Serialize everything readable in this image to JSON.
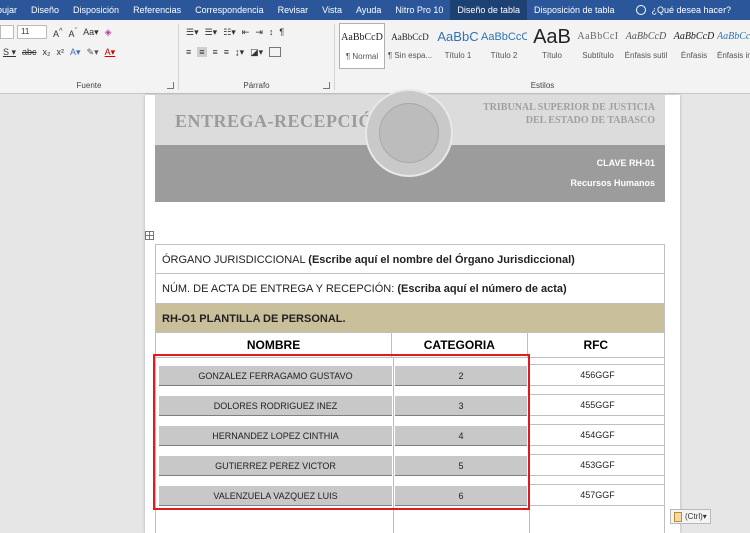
{
  "ribbon_tabs": [
    {
      "label": "bujar"
    },
    {
      "label": "Diseño"
    },
    {
      "label": "Disposición"
    },
    {
      "label": "Referencias"
    },
    {
      "label": "Correspondencia"
    },
    {
      "label": "Revisar"
    },
    {
      "label": "Vista"
    },
    {
      "label": "Ayuda"
    },
    {
      "label": "Nitro Pro 10"
    },
    {
      "label": "Diseño de tabla"
    },
    {
      "label": "Disposición de tabla"
    }
  ],
  "tell_me": "¿Qué desea hacer?",
  "groups": {
    "font_label": "Fuente",
    "paragraph_label": "Párrafo",
    "styles_label": "Estilos",
    "font_size": "11"
  },
  "styles": [
    {
      "sample": "AaBbCcD",
      "name": "¶ Normal"
    },
    {
      "sample": "AaBbCcD",
      "name": "¶ Sin espa..."
    },
    {
      "sample": "AaBbC",
      "name": "Título 1"
    },
    {
      "sample": "AaBbCcC",
      "name": "Título 2"
    },
    {
      "sample": "AaB",
      "name": "Título"
    },
    {
      "sample": "AaBbCcI",
      "name": "Subtítulo"
    },
    {
      "sample": "AaBbCcD",
      "name": "Énfasis sutil"
    },
    {
      "sample": "AaBbCcD",
      "name": "Énfasis"
    },
    {
      "sample": "AaBbCcD",
      "name": "Énfasis int..."
    }
  ],
  "header": {
    "title": "ENTREGA-RECEPCIÓN",
    "court_line1": "TRIBUNAL SUPERIOR DE JUSTICIA",
    "court_line2": "DEL ESTADO DE TABASCO",
    "clave": "CLAVE RH-01",
    "area": "Recursos Humanos"
  },
  "form": {
    "organo_label": "ÓRGANO JURISDICCIONAL",
    "organo_value": "(Escribe aquí el nombre del Órgano Jurisdiccional)",
    "acta_label": "NÚM. DE ACTA DE ENTREGA Y RECEPCIÓN:",
    "acta_value": "(Escriba aquí el número de acta)",
    "section_title": "RH-O1 PLANTILLA DE PERSONAL."
  },
  "table": {
    "headers": [
      "NOMBRE",
      "CATEGORIA",
      "RFC"
    ],
    "rows": [
      {
        "nombre": "GONZALEZ FERRAGAMO GUSTAVO",
        "categoria": "2",
        "rfc": "456GGF"
      },
      {
        "nombre": "DOLORES RODRIGUEZ INEZ",
        "categoria": "3",
        "rfc": "455GGF"
      },
      {
        "nombre": "HERNANDEZ LOPEZ CINTHIA",
        "categoria": "4",
        "rfc": "454GGF"
      },
      {
        "nombre": "GUTIERREZ PEREZ VICTOR",
        "categoria": "5",
        "rfc": "453GGF"
      },
      {
        "nombre": "VALENZUELA VAZQUEZ LUIS",
        "categoria": "6",
        "rfc": "457GGF"
      }
    ]
  },
  "paste_options": "(Ctrl)",
  "colors": {
    "ribbon_blue": "#2b579a",
    "section_tan": "#c9bf9b",
    "highlight_red": "#e01b1b"
  }
}
